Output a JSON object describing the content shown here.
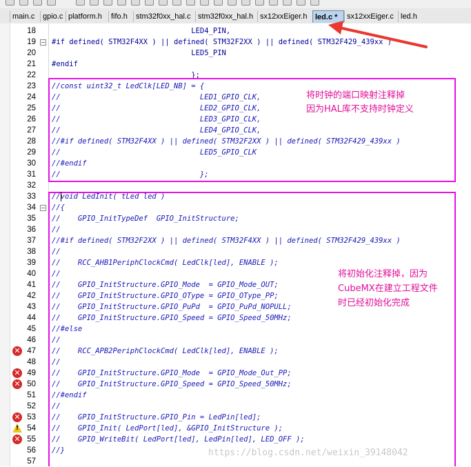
{
  "tabs": [
    {
      "label": "main.c",
      "active": false
    },
    {
      "label": "gpio.c",
      "active": false
    },
    {
      "label": "platform.h",
      "active": false
    },
    {
      "label": "fifo.h",
      "active": false
    },
    {
      "label": "stm32f0xx_hal.c",
      "active": false
    },
    {
      "label": "stm32f0xx_hal.h",
      "active": false
    },
    {
      "label": "sx12xxEiger.h",
      "active": false
    },
    {
      "label": "led.c *",
      "active": true
    },
    {
      "label": "sx12xxEiger.c",
      "active": false
    },
    {
      "label": "led.h",
      "active": false
    }
  ],
  "lines": [
    {
      "num": "18",
      "text": "                                LED4_PIN,",
      "comment": false,
      "marker": "",
      "fold": ""
    },
    {
      "num": "19",
      "text": "#if defined( STM32F4XX ) || defined( STM32F2XX ) || defined( STM32F429_439xx )",
      "comment": false,
      "marker": "",
      "fold": "-"
    },
    {
      "num": "20",
      "text": "                                LED5_PIN",
      "comment": false,
      "marker": "",
      "fold": ""
    },
    {
      "num": "21",
      "text": "#endif",
      "comment": false,
      "marker": "",
      "fold": ""
    },
    {
      "num": "22",
      "text": "                                };",
      "comment": false,
      "marker": "",
      "fold": ""
    },
    {
      "num": "23",
      "text": "//const uint32_t LedClk[LED_NB] = {",
      "comment": true,
      "marker": "",
      "fold": ""
    },
    {
      "num": "24",
      "text": "//                                LED1_GPIO_CLK,",
      "comment": true,
      "marker": "",
      "fold": ""
    },
    {
      "num": "25",
      "text": "//                                LED2_GPIO_CLK,",
      "comment": true,
      "marker": "",
      "fold": ""
    },
    {
      "num": "26",
      "text": "//                                LED3_GPIO_CLK,",
      "comment": true,
      "marker": "",
      "fold": ""
    },
    {
      "num": "27",
      "text": "//                                LED4_GPIO_CLK,",
      "comment": true,
      "marker": "",
      "fold": ""
    },
    {
      "num": "28",
      "text": "//#if defined( STM32F4XX ) || defined( STM32F2XX ) || defined( STM32F429_439xx )",
      "comment": true,
      "marker": "",
      "fold": ""
    },
    {
      "num": "29",
      "text": "//                                LED5_GPIO_CLK",
      "comment": true,
      "marker": "",
      "fold": ""
    },
    {
      "num": "30",
      "text": "//#endif",
      "comment": true,
      "marker": "",
      "fold": ""
    },
    {
      "num": "31",
      "text": "//                                };",
      "comment": true,
      "marker": "",
      "fold": ""
    },
    {
      "num": "32",
      "text": "",
      "comment": false,
      "marker": "",
      "fold": ""
    },
    {
      "num": "33",
      "text": "//void LedInit( tLed led )",
      "comment": true,
      "marker": "",
      "fold": ""
    },
    {
      "num": "34",
      "text": "//{",
      "comment": true,
      "marker": "",
      "fold": "-"
    },
    {
      "num": "35",
      "text": "//    GPIO_InitTypeDef  GPIO_InitStructure;",
      "comment": true,
      "marker": "",
      "fold": ""
    },
    {
      "num": "36",
      "text": "//",
      "comment": true,
      "marker": "",
      "fold": ""
    },
    {
      "num": "37",
      "text": "//#if defined( STM32F2XX ) || defined( STM32F4XX ) || defined( STM32F429_439xx )",
      "comment": true,
      "marker": "",
      "fold": ""
    },
    {
      "num": "38",
      "text": "//",
      "comment": true,
      "marker": "",
      "fold": ""
    },
    {
      "num": "39",
      "text": "//    RCC_AHB1PeriphClockCmd( LedClk[led], ENABLE );",
      "comment": true,
      "marker": "",
      "fold": ""
    },
    {
      "num": "40",
      "text": "//",
      "comment": true,
      "marker": "",
      "fold": ""
    },
    {
      "num": "41",
      "text": "//    GPIO_InitStructure.GPIO_Mode  = GPIO_Mode_OUT;",
      "comment": true,
      "marker": "",
      "fold": ""
    },
    {
      "num": "42",
      "text": "//    GPIO_InitStructure.GPIO_OType = GPIO_OType_PP;",
      "comment": true,
      "marker": "",
      "fold": ""
    },
    {
      "num": "43",
      "text": "//    GPIO_InitStructure.GPIO_PuPd  = GPIO_PuPd_NOPULL;",
      "comment": true,
      "marker": "",
      "fold": ""
    },
    {
      "num": "44",
      "text": "//    GPIO_InitStructure.GPIO_Speed = GPIO_Speed_50MHz;",
      "comment": true,
      "marker": "",
      "fold": ""
    },
    {
      "num": "45",
      "text": "//#else",
      "comment": true,
      "marker": "",
      "fold": ""
    },
    {
      "num": "46",
      "text": "//",
      "comment": true,
      "marker": "",
      "fold": ""
    },
    {
      "num": "47",
      "text": "//    RCC_APB2PeriphClockCmd( LedClk[led], ENABLE );",
      "comment": true,
      "marker": "error",
      "fold": ""
    },
    {
      "num": "48",
      "text": "//",
      "comment": true,
      "marker": "",
      "fold": ""
    },
    {
      "num": "49",
      "text": "//    GPIO_InitStructure.GPIO_Mode  = GPIO_Mode_Out_PP;",
      "comment": true,
      "marker": "error",
      "fold": ""
    },
    {
      "num": "50",
      "text": "//    GPIO_InitStructure.GPIO_Speed = GPIO_Speed_50MHz;",
      "comment": true,
      "marker": "error",
      "fold": ""
    },
    {
      "num": "51",
      "text": "//#endif",
      "comment": true,
      "marker": "",
      "fold": ""
    },
    {
      "num": "52",
      "text": "//",
      "comment": true,
      "marker": "",
      "fold": ""
    },
    {
      "num": "53",
      "text": "//    GPIO_InitStructure.GPIO_Pin = LedPin[led];",
      "comment": true,
      "marker": "error",
      "fold": ""
    },
    {
      "num": "54",
      "text": "//    GPIO_Init( LedPort[led], &GPIO_InitStructure );",
      "comment": true,
      "marker": "warning",
      "fold": ""
    },
    {
      "num": "55",
      "text": "//    GPIO_WriteBit( LedPort[led], LedPin[led], LED_OFF );",
      "comment": true,
      "marker": "error",
      "fold": ""
    },
    {
      "num": "56",
      "text": "//}",
      "comment": true,
      "marker": "",
      "fold": ""
    },
    {
      "num": "57",
      "text": "",
      "comment": false,
      "marker": "",
      "fold": ""
    }
  ],
  "annotations": {
    "note1_line1": "将时钟的端口映射注释掉",
    "note1_line2": "因为HAL库不支持时钟定义",
    "note2_line1": "将初始化注释掉，因为",
    "note2_line2": "CubeMX在建立工程文件",
    "note2_line3": "时已经初始化完成"
  },
  "watermark": "https://blog.csdn.net/weixin_39148042",
  "colors": {
    "annotation": "#e60fe6",
    "annotation_text": "#e0109a",
    "code_keyword": "#00009a",
    "arrow": "#e8382f"
  }
}
